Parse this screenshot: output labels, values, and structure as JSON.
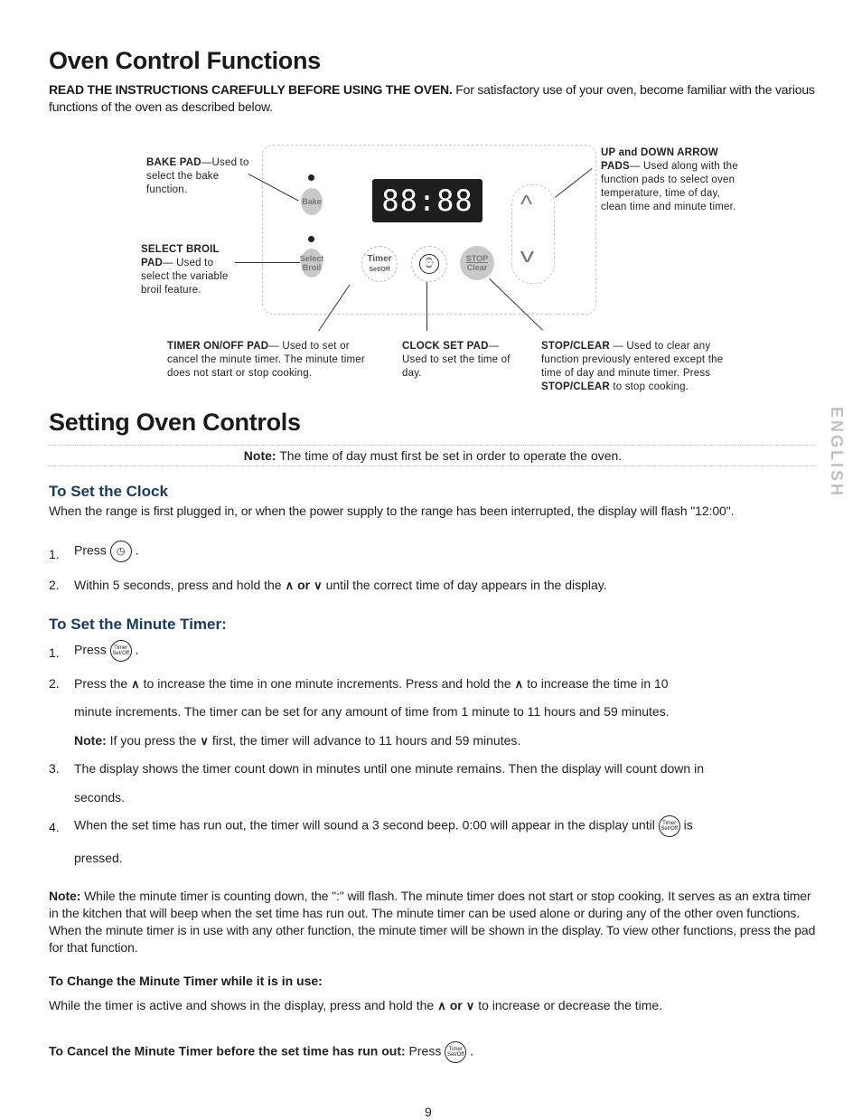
{
  "section1": {
    "title": "Oven Control Functions",
    "intro_bold": "READ THE INSTRUCTIONS CAREFULLY BEFORE USING THE OVEN.",
    "intro_rest": " For satisfactory use of your oven, become familiar with the various functions of the oven as described below."
  },
  "diagram": {
    "display": "88:88",
    "pads": {
      "bake": "Bake",
      "select": "Select",
      "broil": "Broil",
      "timer": "Timer",
      "timer_sub": "Set/Off",
      "stop": "STOP",
      "clear": "Clear"
    },
    "callouts": {
      "bake_title": "BAKE PAD",
      "bake_text": "—Used to select the bake function.",
      "broil_title": "SELECT BROIL PAD",
      "broil_text": "— Used to select the variable broil feature.",
      "arrows_title": "UP and DOWN ARROW PADS",
      "arrows_text": "— Used along with the function pads to select oven temperature, time of day, clean time and minute timer.",
      "timer_title": "TIMER ON/OFF PAD",
      "timer_text": "— Used to set or cancel the minute timer. The minute timer does not start or stop cooking.",
      "clock_title": "CLOCK SET PAD",
      "clock_text": "— Used to set the time of day.",
      "stop_title": "STOP/CLEAR",
      "stop_text": " — Used to clear any function previously entered except the time of day and minute timer. Press ",
      "stop_bold2": "STOP/CLEAR",
      "stop_text2": " to stop cooking."
    }
  },
  "section2": {
    "title": "Setting Oven Controls",
    "note_bold": "Note:",
    "note_text": " The time of day must first be set in order to operate the oven."
  },
  "side_tab": "ENGLISH",
  "clock": {
    "heading": "To Set the Clock",
    "intro": "When the range is first plugged in, or when the power supply to the range has been interrupted, the display will flash \"12:00\".",
    "step1_num": "1.",
    "step1_text": "Press",
    "step2_num": "2.",
    "step2_a": "Within 5 seconds, press and hold the",
    "step2_or": "or",
    "step2_b": "until the correct time of day appears in the display."
  },
  "timer": {
    "heading": "To Set the Minute Timer:",
    "step1_num": "1.",
    "step1_text": "Press",
    "icon_top": "Timer",
    "icon_bottom": "Set/Off",
    "step2_num": "2.",
    "step2_a": "Press the",
    "step2_b": "to increase the time in one minute increments. Press and hold the",
    "step2_c": "to increase the time in 10",
    "step2_line2": "minute increments. The timer can be set for any amount of time from 1 minute to 11 hours and 59 minutes.",
    "step2_note_bold": "Note:",
    "step2_note_a": " If you press the",
    "step2_note_b": "first, the timer will advance to 11 hours and 59 minutes.",
    "step3_num": "3.",
    "step3_line1": "The display shows the timer count down in minutes until one minute remains. Then the display will count down in",
    "step3_line2": "seconds.",
    "step4_num": "4.",
    "step4_a": "When the set time has run out, the timer will sound a 3 second beep. 0:00 will appear in the display until",
    "step4_b": "is",
    "step4_line2": "pressed.",
    "note_bold": "Note:",
    "note_text": " While the minute timer is counting down, the \":\" will flash. The minute timer does not start or stop cooking. It serves as an extra timer in the kitchen that will beep when the set time has run out. The minute timer can be used alone or during any of the other oven functions. When the minute timer is in use with any other function, the minute timer will be shown in the display. To view other functions, press the pad for that function."
  },
  "change": {
    "heading": "To Change the Minute Timer while it is in use:",
    "text_a": "While the timer is active and shows in the display, press and hold the",
    "text_or": "or",
    "text_b": "to increase or decrease the time."
  },
  "cancel": {
    "heading": "To Cancel the Minute Timer before the set time has run out:",
    "press": "Press"
  },
  "page_number": "9"
}
